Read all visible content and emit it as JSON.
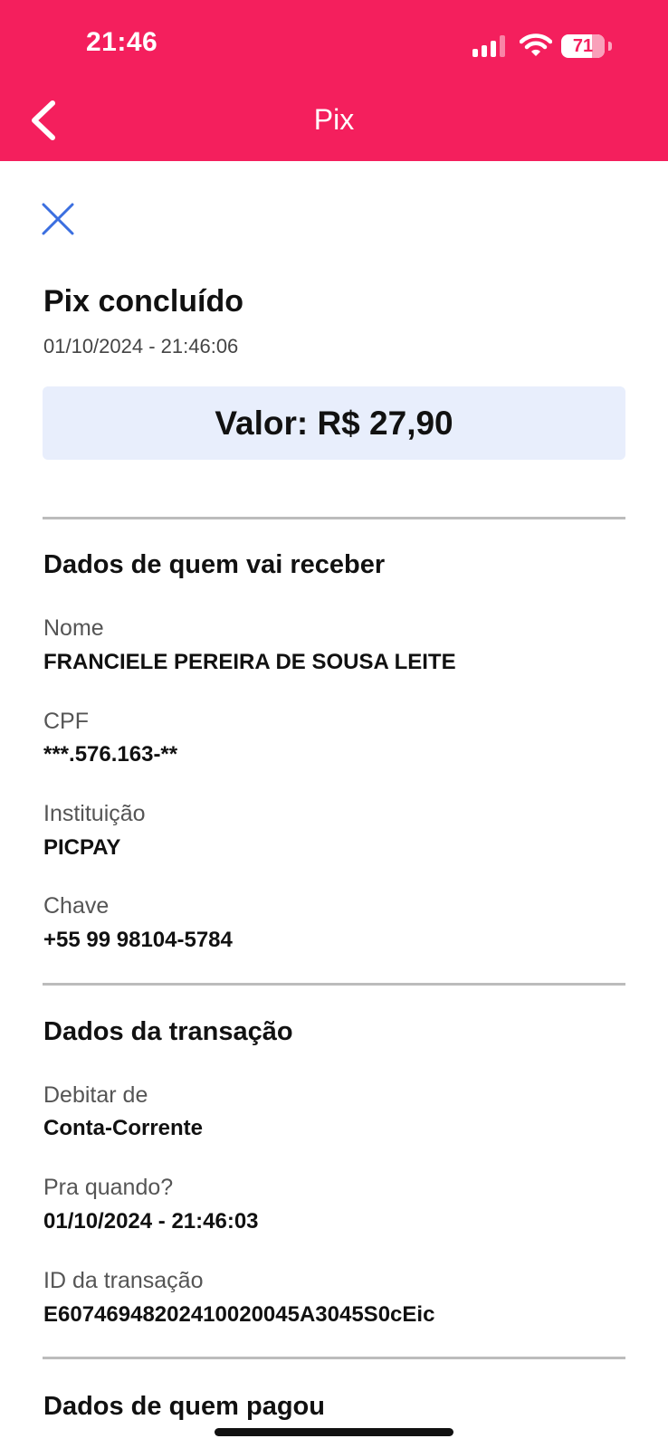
{
  "status_bar": {
    "time": "21:46",
    "battery_percent": "71",
    "battery_level": 0.71,
    "signal_bars": 4
  },
  "nav": {
    "title": "Pix",
    "back_icon": "chevron-left-icon",
    "close_icon": "close-icon"
  },
  "receipt": {
    "title": "Pix concluído",
    "timestamp": "01/10/2024 - 21:46:06",
    "amount_label": "Valor: R$ 27,90"
  },
  "receiver": {
    "section_title": "Dados de quem vai receber",
    "fields": [
      {
        "label": "Nome",
        "value": "FRANCIELE PEREIRA DE SOUSA LEITE"
      },
      {
        "label": "CPF",
        "value": "***.576.163-**"
      },
      {
        "label": "Instituição",
        "value": "PICPAY"
      },
      {
        "label": "Chave",
        "value": "+55 99 98104-5784"
      }
    ]
  },
  "transaction": {
    "section_title": "Dados da transação",
    "fields": [
      {
        "label": "Debitar de",
        "value": "Conta-Corrente"
      },
      {
        "label": "Pra quando?",
        "value": "01/10/2024 - 21:46:03"
      },
      {
        "label": "ID da transação",
        "value": "E60746948202410020045A3045S0cEic"
      }
    ]
  },
  "payer": {
    "section_title": "Dados de quem pagou"
  },
  "colors": {
    "brand": "#f41f5d",
    "amount_bg": "#e8eefc",
    "close_icon": "#3b6fe0"
  }
}
